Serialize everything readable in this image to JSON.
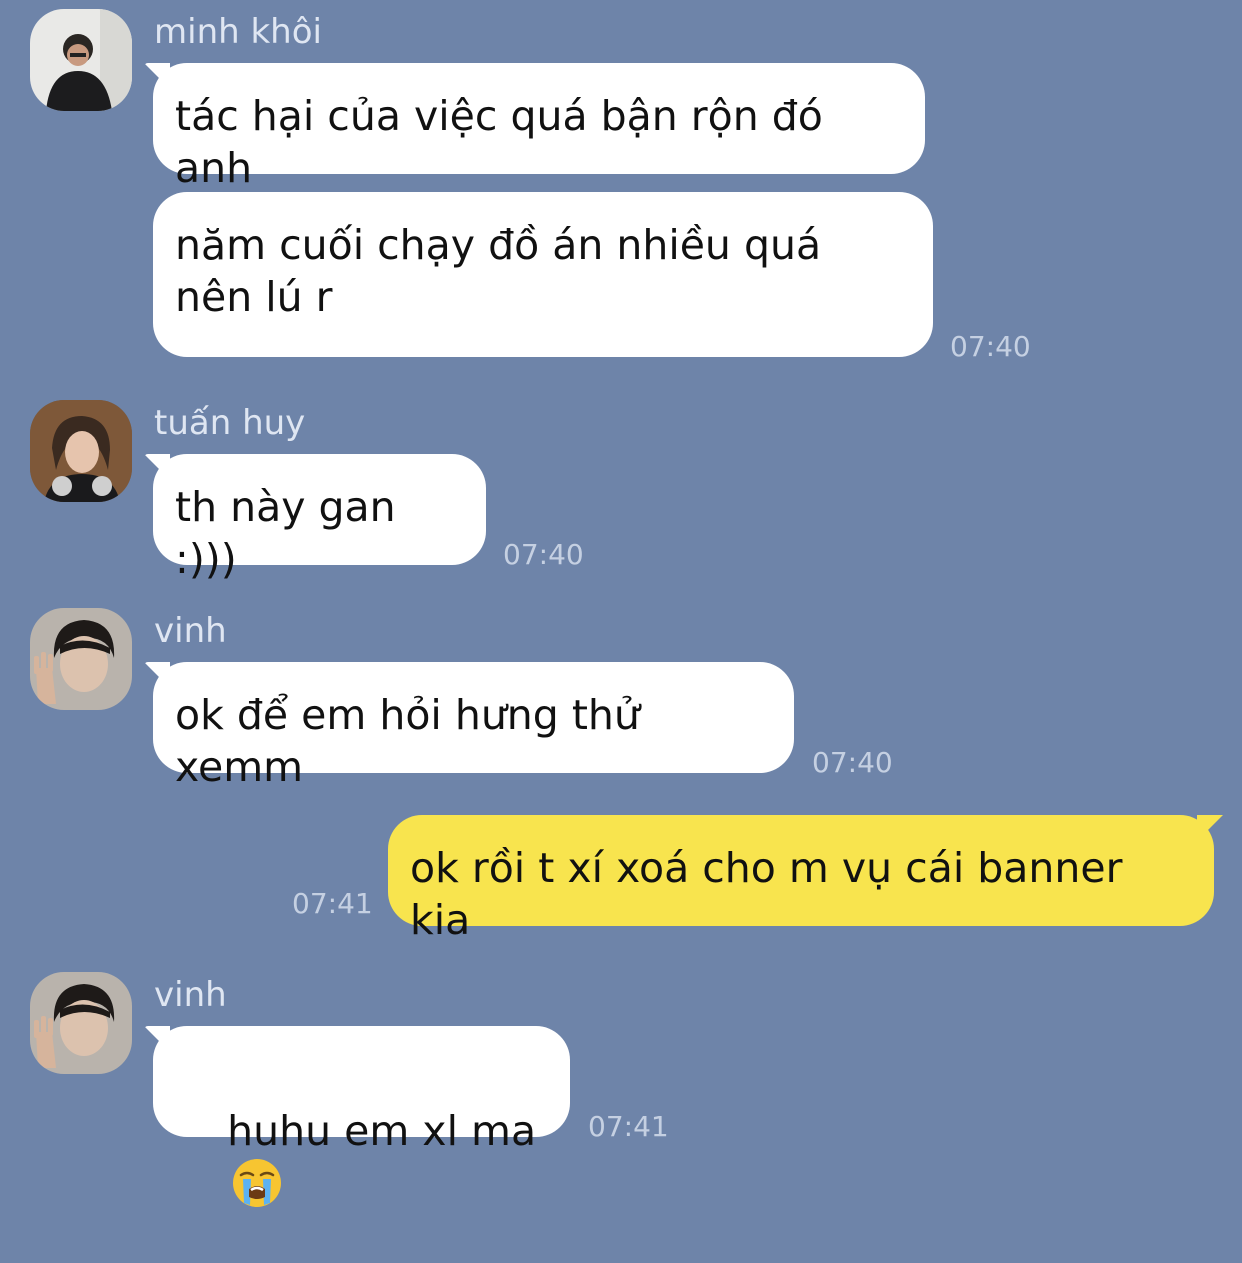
{
  "messages": [
    {
      "sender": "minh khôi",
      "avatar": "avatar-minh-khoi",
      "bubbles": [
        "tác hại của việc quá bận rộn đó anh",
        "năm cuối chạy đồ án nhiều quá nên lú r"
      ],
      "time": "07:40"
    },
    {
      "sender": "tuấn huy",
      "avatar": "avatar-tuan-huy",
      "bubbles": [
        "th này gan :)))"
      ],
      "time": "07:40"
    },
    {
      "sender": "vinh",
      "avatar": "avatar-vinh",
      "bubbles": [
        "ok để em hỏi hưng thử xemm"
      ],
      "time": "07:40"
    },
    {
      "sender": "me",
      "bubbles": [
        "ok rồi t xí xoá cho m vụ cái banner kia"
      ],
      "time": "07:41"
    },
    {
      "sender": "vinh",
      "avatar": "avatar-vinh",
      "bubbles": [
        "huhu em xl ma"
      ],
      "emoji": "loudly-crying-face-icon",
      "time": "07:41"
    }
  ],
  "colors": {
    "background": "#6e84a9",
    "incoming_bubble": "#ffffff",
    "outgoing_bubble": "#f8e44e",
    "sender_name": "#dfe6f2",
    "timestamp": "#c5d0e2"
  }
}
